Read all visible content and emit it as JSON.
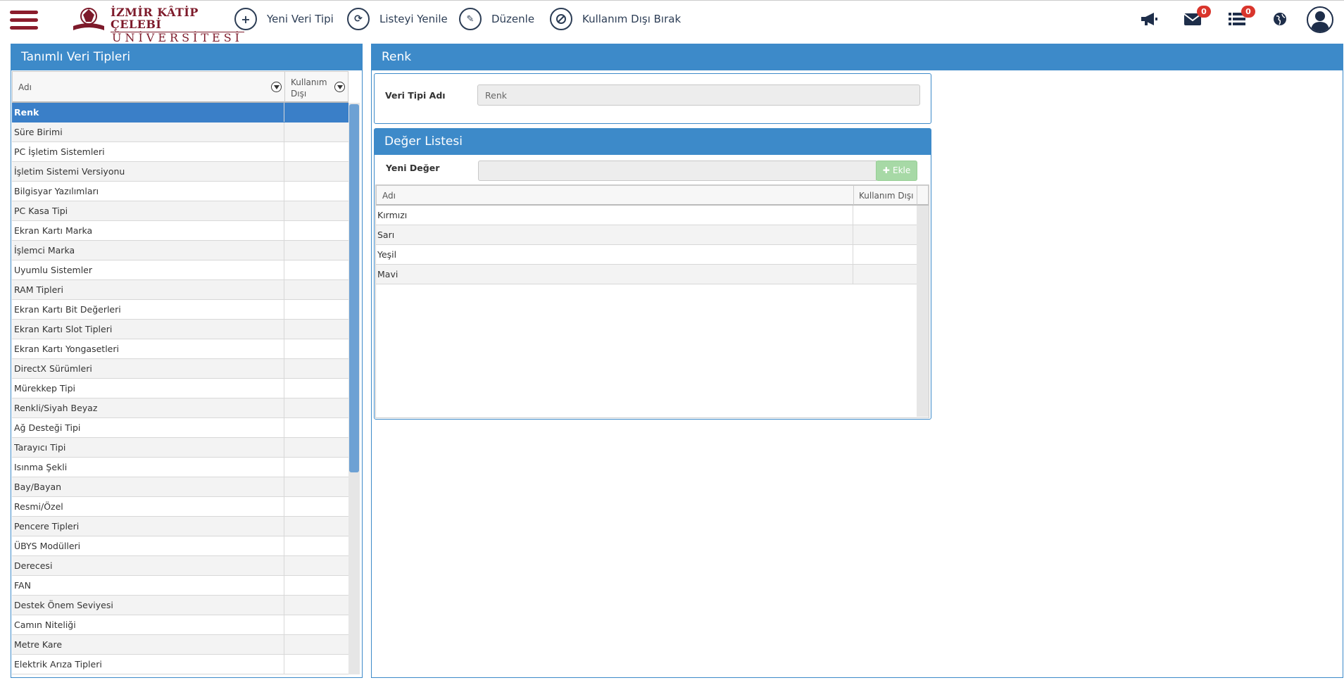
{
  "header": {
    "logo": {
      "line1": "İZMİR KÂTİP ÇELEBİ",
      "line2": "ÜNİVERSİTESİ"
    },
    "toolbar": [
      {
        "icon": "plus-icon",
        "label": "Yeni Veri Tipi"
      },
      {
        "icon": "refresh-icon",
        "label": "Listeyi Yenile"
      },
      {
        "icon": "pencil-icon",
        "label": "Düzenle"
      },
      {
        "icon": "ban-icon",
        "label": "Kullanım Dışı Bırak"
      }
    ],
    "icons": {
      "announcements": "megaphone-icon",
      "messages": {
        "icon": "envelope-icon",
        "count": "0"
      },
      "tasks": {
        "icon": "list-icon",
        "count": "0"
      },
      "language": "globe-icon",
      "profile": "user-icon"
    }
  },
  "left_panel": {
    "title": "Tanımlı Veri Tipleri",
    "columns": [
      "Adı",
      "Kullanım Dışı"
    ],
    "rows": [
      "Renk",
      "Süre Birimi",
      "PC İşletim Sistemleri",
      "İşletim Sistemi Versiyonu",
      "Bilgisyar Yazılımları",
      "PC Kasa Tipi",
      "Ekran Kartı Marka",
      "İşlemci Marka",
      "Uyumlu Sistemler",
      "RAM Tipleri",
      "Ekran Kartı Bit Değerleri",
      "Ekran Kartı Slot Tipleri",
      "Ekran Kartı Yongasetleri",
      "DirectX Sürümleri",
      "Mürekkep Tipi",
      "Renkli/Siyah Beyaz",
      "Ağ Desteği Tipi",
      "Tarayıcı Tipi",
      "Isınma Şekli",
      "Bay/Bayan",
      "Resmi/Özel",
      "Pencere Tipleri",
      "ÜBYS Modülleri",
      "Derecesi",
      "FAN",
      "Destek Önem Seviyesi",
      "Camın Niteliği",
      "Metre Kare",
      "Elektrik Arıza Tipleri"
    ],
    "selected_index": 0
  },
  "right_panel": {
    "title": "Renk",
    "veri_tipi_label": "Veri Tipi Adı",
    "veri_tipi_value": "Renk",
    "deger_listesi": {
      "title": "Değer Listesi",
      "new_value_label": "Yeni Değer",
      "new_value": "",
      "add_button": "Ekle",
      "columns": [
        "Adı",
        "Kullanım Dışı"
      ],
      "rows": [
        "Kırmızı",
        "Sarı",
        "Yeşil",
        "Mavi"
      ]
    }
  },
  "colors": {
    "accent": "#3d8ac9",
    "selected_row": "#3a7fc8",
    "brand": "#8b1c2c",
    "badge": "#d9352c",
    "add_button": "#a7d9a6"
  }
}
